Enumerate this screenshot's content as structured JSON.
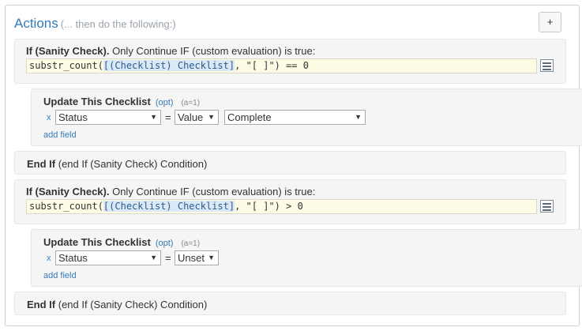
{
  "header": {
    "title": "Actions",
    "subtitle": "(... then do the following:)",
    "add_label": "+"
  },
  "blocks": [
    {
      "if_label": "If (Sanity Check).",
      "if_desc": "Only Continue IF (custom evaluation) is true:",
      "expr_pre": "substr_count(",
      "expr_ref": "[(Checklist) Checklist]",
      "expr_post": ", \"[ ]\") == 0",
      "update_title": "Update This Checklist",
      "opt": "(opt)",
      "count": "(a=1)",
      "remove": "x",
      "field": "Status",
      "eq": "=",
      "mode": "Value",
      "value": "Complete",
      "add_field": "add field",
      "endif_label": "End If",
      "endif_desc": "(end If (Sanity Check) Condition)"
    },
    {
      "if_label": "If (Sanity Check).",
      "if_desc": "Only Continue IF (custom evaluation) is true:",
      "expr_pre": "substr_count(",
      "expr_ref": "[(Checklist) Checklist]",
      "expr_post": ", \"[ ]\") > 0",
      "update_title": "Update This Checklist",
      "opt": "(opt)",
      "count": "(a=1)",
      "remove": "x",
      "field": "Status",
      "eq": "=",
      "mode": "Unset",
      "add_field": "add field",
      "endif_label": "End If",
      "endif_desc": "(end If (Sanity Check) Condition)"
    }
  ],
  "icons": {
    "expression_editor": "list-editor-icon",
    "dropdown": "chevron-down-icon"
  },
  "colors": {
    "accent": "#337ab7",
    "expr_bg": "#fffce6",
    "ref_bg": "#dbe8f5"
  }
}
